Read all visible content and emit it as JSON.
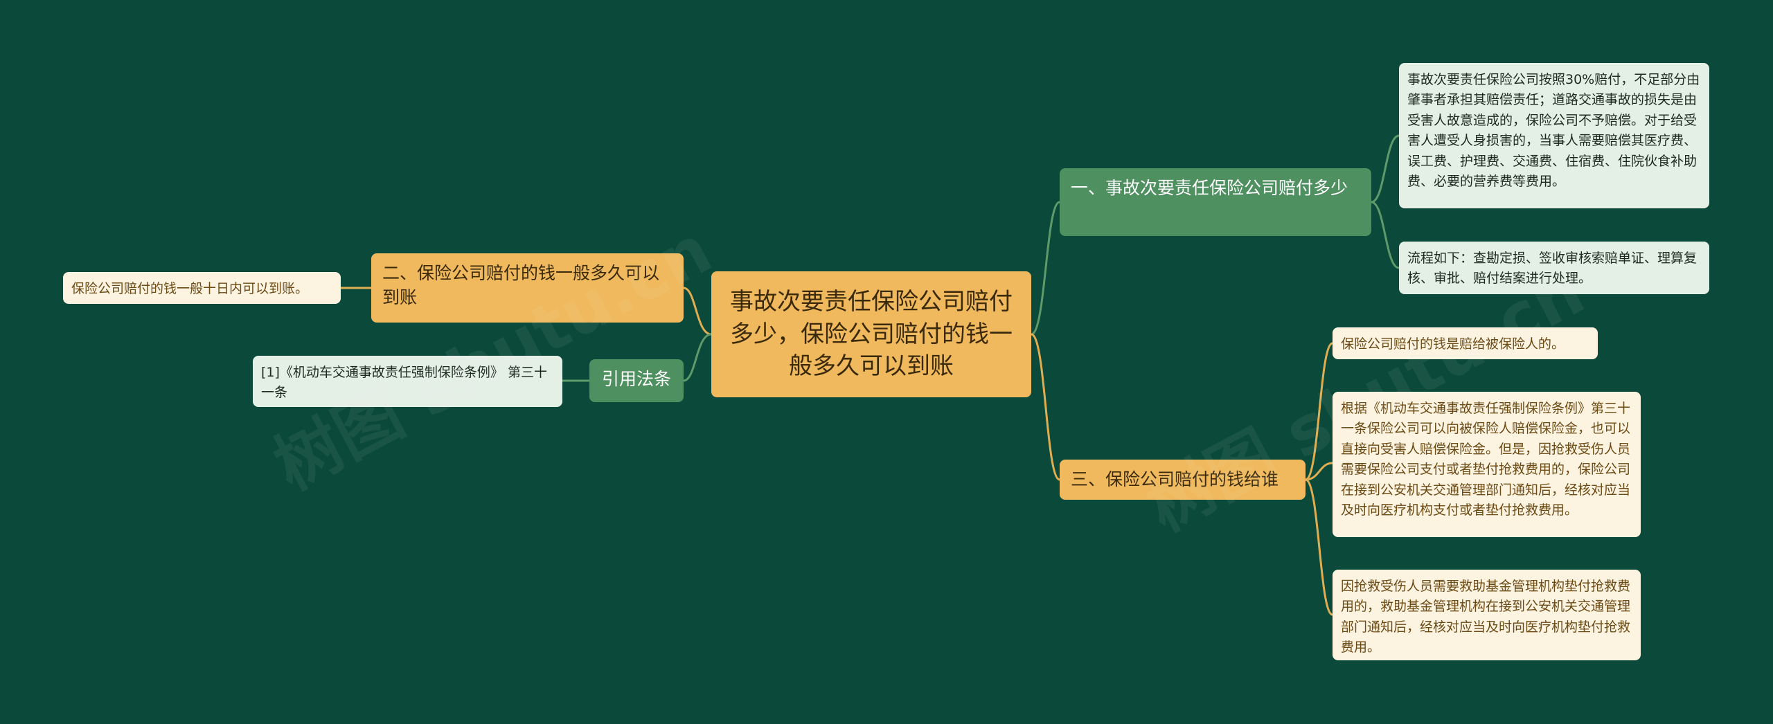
{
  "root": {
    "text": "事故次要责任保险公司赔付多少，保险公司赔付的钱一般多久可以到账"
  },
  "branches": {
    "b1": {
      "label": "一、事故次要责任保险公司赔付多少",
      "leaves": [
        "事故次要责任保险公司按照30%赔付，不足部分由肇事者承担其赔偿责任；道路交通事故的损失是由受害人故意造成的，保险公司不予赔偿。对于给受害人遭受人身损害的，当事人需要赔偿其医疗费、误工费、护理费、交通费、住宿费、住院伙食补助费、必要的营养费等费用。",
        "流程如下：查勘定损、签收审核索赔单证、理算复核、审批、赔付结案进行处理。"
      ]
    },
    "b2": {
      "label": "二、保险公司赔付的钱一般多久可以到账",
      "leaves": [
        "保险公司赔付的钱一般十日内可以到账。"
      ]
    },
    "b3": {
      "label": "三、保险公司赔付的钱给谁",
      "leaves": [
        "保险公司赔付的钱是赔给被保险人的。",
        "根据《机动车交通事故责任强制保险条例》第三十一条保险公司可以向被保险人赔偿保险金，也可以直接向受害人赔偿保险金。但是，因抢救受伤人员需要保险公司支付或者垫付抢救费用的，保险公司在接到公安机关交通管理部门通知后，经核对应当及时向医疗机构支付或者垫付抢救费用。",
        "因抢救受伤人员需要救助基金管理机构垫付抢救费用的，救助基金管理机构在接到公安机关交通管理部门通知后，经核对应当及时向医疗机构垫付抢救费用。"
      ]
    },
    "cite": {
      "label": "引用法条",
      "leaves": [
        "[1]《机动车交通事故责任强制保险条例》 第三十一条"
      ]
    }
  },
  "watermark": {
    "text": "树图 shutu.cn"
  },
  "colors": {
    "background": "#0b4a3a",
    "orange": "#f0b95e",
    "green": "#4f9060",
    "green_line": "#5e9a6a",
    "orange_line": "#e0ad52"
  }
}
